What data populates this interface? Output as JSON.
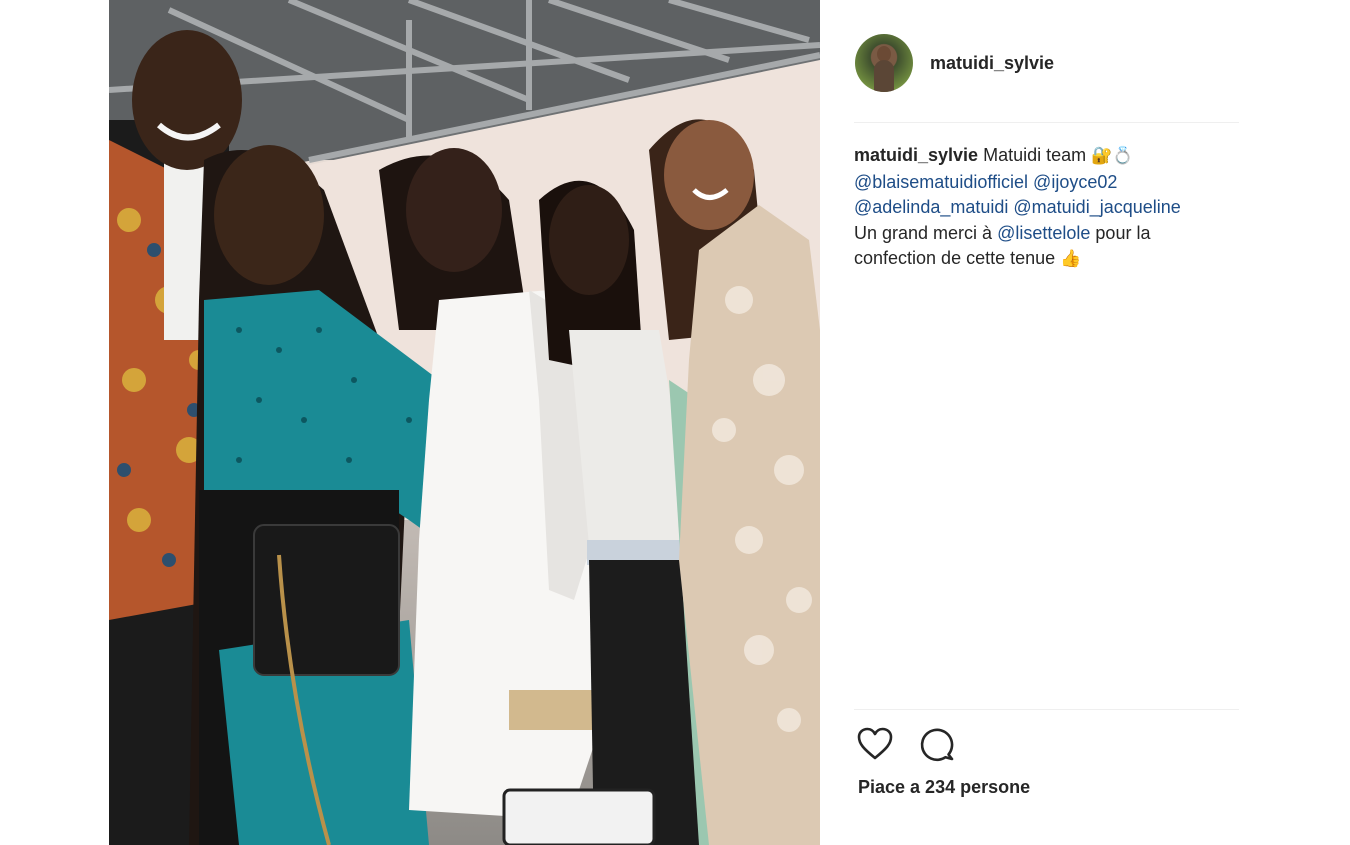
{
  "post": {
    "photo_icon": "group-photo",
    "author": {
      "username": "matuidi_sylvie",
      "avatar_icon": "avatar"
    },
    "caption": {
      "username": "matuidi_sylvie",
      "text_1": "Matuidi team",
      "emoji_1": "🔐💍",
      "mention_1": "@blaisematuidiofficiel",
      "mention_2": "@ijoyce02",
      "mention_3": "@adelinda_matuidi",
      "mention_4": "@matuidi_jacqueline",
      "text_2": "Un grand merci à",
      "mention_5": "@lisettelole",
      "text_3": "pour la",
      "text_4": "confection de cette tenue",
      "emoji_2": "👍"
    },
    "actions": {
      "like_icon": "heart-icon",
      "comment_icon": "comment-icon"
    },
    "likes_text": "Piace a 234 persone"
  },
  "colors": {
    "mention": "#1e4d87",
    "text": "#262626",
    "divider": "#efefef"
  }
}
